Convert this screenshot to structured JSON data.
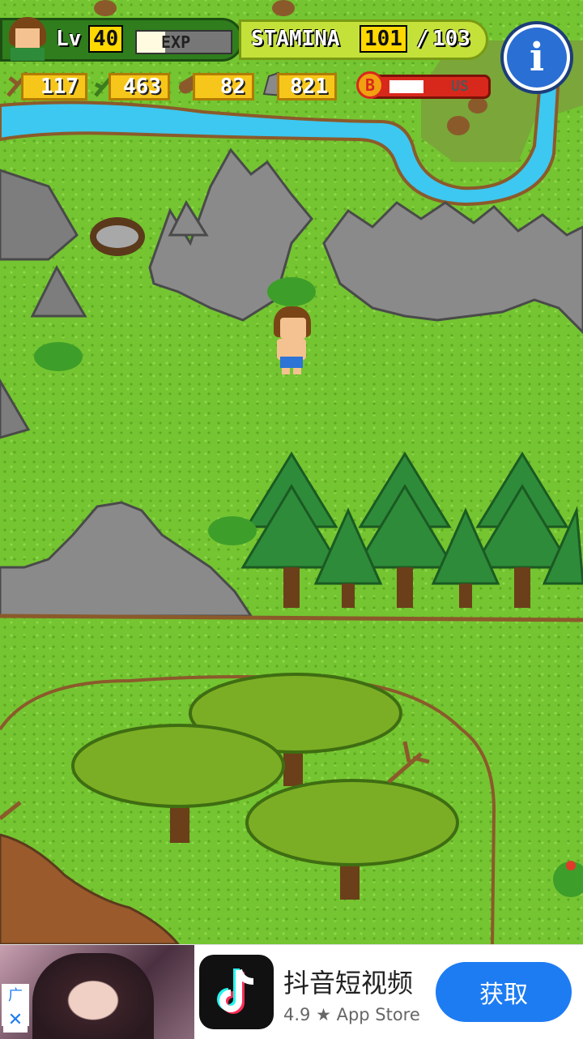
{
  "hud": {
    "level_label": "Lv",
    "level_value": "40",
    "exp_label": "EXP",
    "exp_fraction": 0.3,
    "stamina_label": "STAMINA",
    "stamina_current": "101",
    "stamina_separator": "/",
    "stamina_max": "103",
    "boost_label": "US",
    "boost_fraction": 0.5,
    "boost_coin": "B"
  },
  "resources": [
    {
      "icon": "branch-icon",
      "value": "117"
    },
    {
      "icon": "vine-icon",
      "value": "463"
    },
    {
      "icon": "wood-log-icon",
      "value": "82"
    },
    {
      "icon": "stone-icon",
      "value": "821"
    }
  ],
  "info_button": {
    "label": "i"
  },
  "ad": {
    "tag": "广告",
    "close": "✕",
    "app_name": "抖音短视频",
    "rating": "4.9 ★ App Store",
    "cta": "获取"
  },
  "colors": {
    "grass": "#74c531",
    "river": "#3cc8f0",
    "rock": "#7d7d7d",
    "pine": "#2e8b3a",
    "hud_green": "#2f7d1d",
    "stamina_yellow": "#c4e13a",
    "cta_blue": "#1d7cf2"
  }
}
